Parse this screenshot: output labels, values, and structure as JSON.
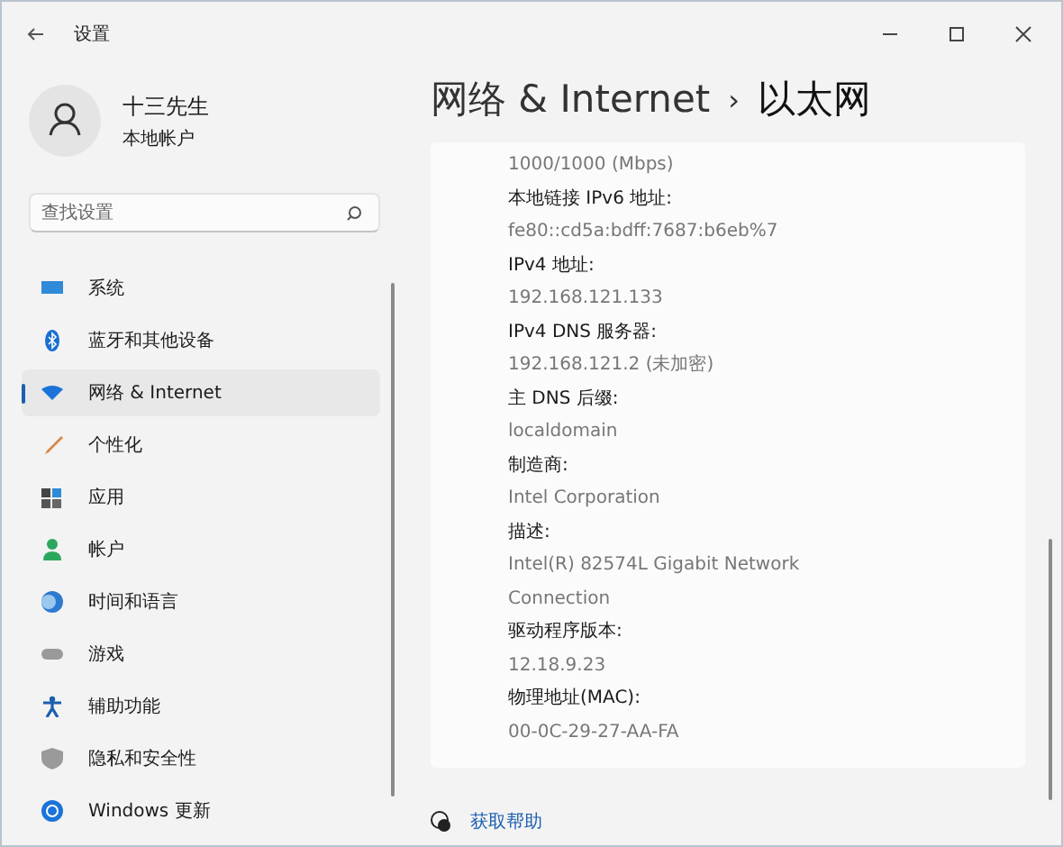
{
  "window": {
    "title": "设置"
  },
  "user": {
    "name": "十三先生",
    "account": "本地帐户"
  },
  "search": {
    "placeholder": "查找设置"
  },
  "sidebar": {
    "items": [
      {
        "label": "系统",
        "selected": false
      },
      {
        "label": "蓝牙和其他设备",
        "selected": false
      },
      {
        "label": "网络 & Internet",
        "selected": true
      },
      {
        "label": "个性化",
        "selected": false
      },
      {
        "label": "应用",
        "selected": false
      },
      {
        "label": "帐户",
        "selected": false
      },
      {
        "label": "时间和语言",
        "selected": false
      },
      {
        "label": "游戏",
        "selected": false
      },
      {
        "label": "辅助功能",
        "selected": false
      },
      {
        "label": "隐私和安全性",
        "selected": false
      },
      {
        "label": "Windows 更新",
        "selected": false
      }
    ]
  },
  "breadcrumb": {
    "parent": "网络 & Internet",
    "separator": "›",
    "current": "以太网"
  },
  "details": [
    {
      "value": "1000/1000 (Mbps)"
    },
    {
      "label": "本地链接 IPv6 地址:",
      "value": "fe80::cd5a:bdff:7687:b6eb%7"
    },
    {
      "label": "IPv4 地址:",
      "value": "192.168.121.133"
    },
    {
      "label": "IPv4 DNS 服务器:",
      "value": "192.168.121.2 (未加密)"
    },
    {
      "label": "主 DNS 后缀:",
      "value": "localdomain"
    },
    {
      "label": "制造商:",
      "value": "Intel Corporation"
    },
    {
      "label": "描述:",
      "value": "Intel(R) 82574L Gigabit Network Connection"
    },
    {
      "label": "驱动程序版本:",
      "value": "12.18.9.23"
    },
    {
      "label": "物理地址(MAC):",
      "value": "00-0C-29-27-AA-FA"
    }
  ],
  "help": {
    "label": "获取帮助"
  }
}
